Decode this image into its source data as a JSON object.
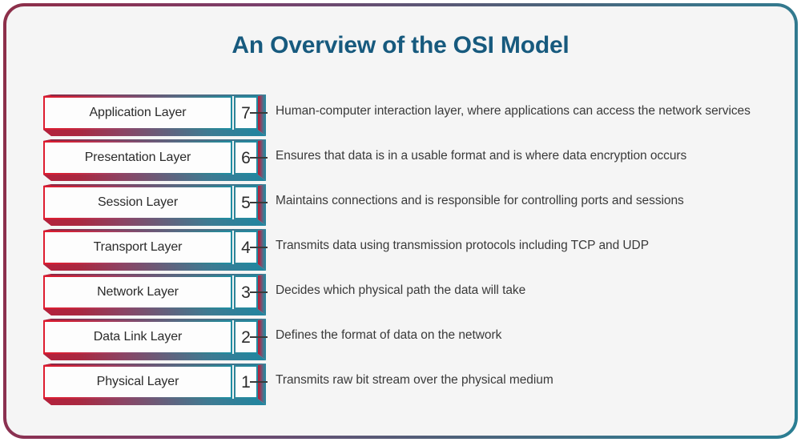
{
  "title": "An Overview of the OSI Model",
  "colors": {
    "title": "#175a7e",
    "frame_start": "#8d2f49",
    "frame_end": "#2a7e93",
    "block_left": "#e01b2e",
    "block_right": "#1d8ea3",
    "text": "#3a3a3a"
  },
  "layers": [
    {
      "number": "7",
      "name": "Application Layer",
      "description": "Human-computer interaction layer, where applications can access the network services"
    },
    {
      "number": "6",
      "name": "Presentation Layer",
      "description": "Ensures that data is in a usable format and is where data encryption occurs"
    },
    {
      "number": "5",
      "name": "Session Layer",
      "description": "Maintains connections and is responsible for controlling ports and sessions"
    },
    {
      "number": "4",
      "name": "Transport Layer",
      "description": "Transmits data using transmission protocols including TCP and UDP"
    },
    {
      "number": "3",
      "name": "Network Layer",
      "description": "Decides which physical path the data will take"
    },
    {
      "number": "2",
      "name": "Data Link Layer",
      "description": "Defines the format of data on the network"
    },
    {
      "number": "1",
      "name": "Physical Layer",
      "description": "Transmits raw bit stream over the physical medium"
    }
  ]
}
